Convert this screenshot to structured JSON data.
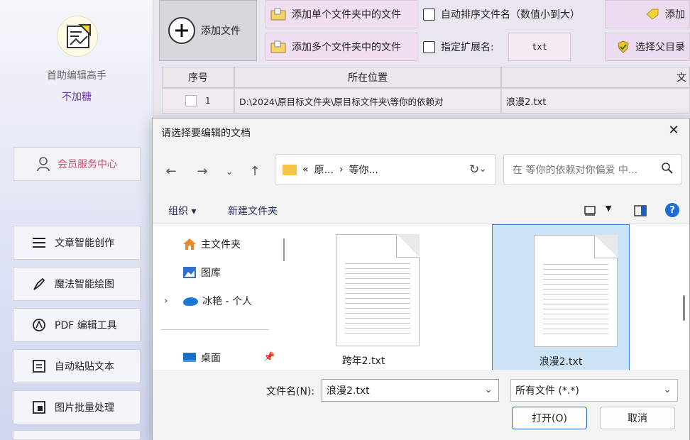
{
  "sidebar": {
    "app_name": "首助编辑高手",
    "app_subtitle": "不加糖",
    "member_label": "会员服务中心",
    "items": [
      {
        "label": "文章智能创作",
        "icon": "list-icon"
      },
      {
        "label": "魔法智能绘图",
        "icon": "brush-icon"
      },
      {
        "label": "PDF 编辑工具",
        "icon": "pdf-icon"
      },
      {
        "label": "自动粘贴文本",
        "icon": "paste-icon"
      },
      {
        "label": "图片批量处理",
        "icon": "image-icon"
      }
    ],
    "accent_color": "#7a2fc0"
  },
  "toolbar": {
    "add_file": "添加文件",
    "add_single_folder": "添加单个文件夹中的文件",
    "add_multi_folder": "添加多个文件夹中的文件",
    "auto_sort": "自动排序文件名（数值小到大）",
    "specify_ext": "指定扩展名:",
    "ext_value": "txt",
    "add_partial": "添加",
    "select_parent": "选择父目录"
  },
  "table": {
    "headers": [
      "序号",
      "所在位置",
      "文"
    ],
    "rows": [
      {
        "index": "1",
        "location": "D:\\2024\\原目标文件夹\\原目标文件夹\\等你的依赖对",
        "file": "浪漫2.txt"
      }
    ]
  },
  "dialog": {
    "title": "请选择要编辑的文档",
    "address": {
      "sep": "«",
      "crumb1": "原...",
      "arrow": "›",
      "crumb2": "等你..."
    },
    "search_placeholder": "在 等你的依赖对你偏爱 中...",
    "organize": "组织 ▾",
    "new_folder": "新建文件夹",
    "tree": [
      {
        "label": "主文件夹",
        "icon": "home-icon"
      },
      {
        "label": "图库",
        "icon": "gallery-icon"
      },
      {
        "label": "冰艳 - 个人",
        "icon": "cloud-icon"
      },
      {
        "label": "桌面",
        "icon": "desktop-icon"
      }
    ],
    "files": [
      {
        "name": "跨年2.txt",
        "selected": false
      },
      {
        "name": "浪漫2.txt",
        "selected": true
      }
    ],
    "filename_label": "文件名(N):",
    "filename_value": "浪漫2.txt",
    "filetype_value": "所有文件 (*.*)",
    "open_label": "打开(O)",
    "cancel_label": "取消",
    "selection_color": "#cce4f7"
  }
}
